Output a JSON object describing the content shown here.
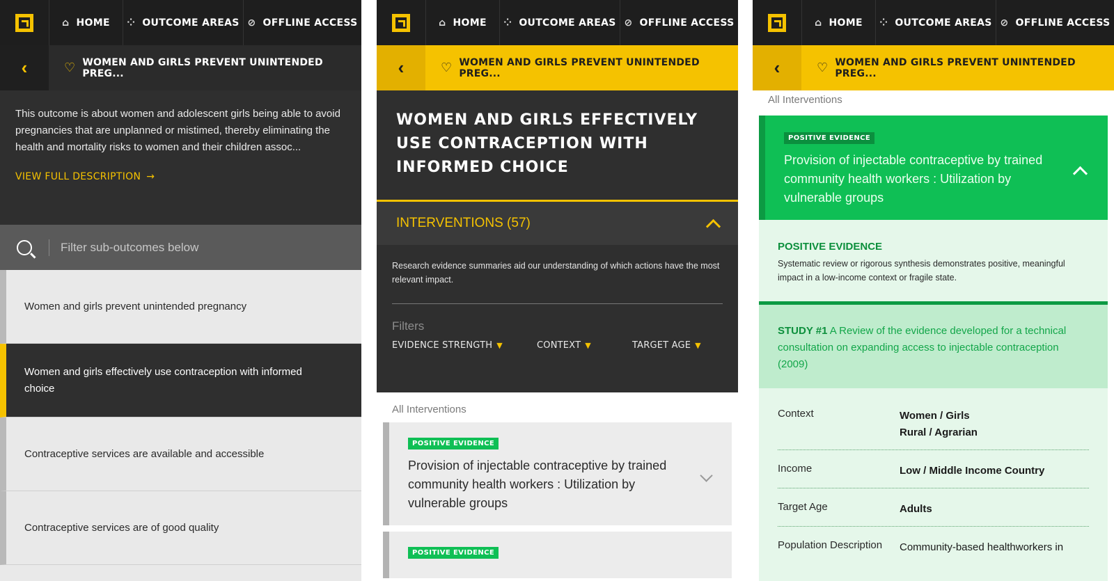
{
  "nav": {
    "home": "HOME",
    "outcome_areas": "OUTCOME AREAS",
    "offline_access": "OFFLINE ACCESS"
  },
  "breadcrumb": {
    "title": "WOMEN AND GIRLS PREVENT UNINTENDED PREG..."
  },
  "panel1": {
    "description": "This outcome is about women and adolescent girls being able to avoid pregnancies that are unplanned or mistimed, thereby eliminating the health and mortality risks to women and their children assoc...",
    "view_full": "VIEW FULL DESCRIPTION",
    "search_placeholder": "Filter sub-outcomes below",
    "sub_outcomes": [
      "Women and girls prevent unintended pregnancy",
      "Women and girls effectively use contraception with informed choice",
      "Contraceptive services are available and accessible",
      "Contraceptive services are of good quality"
    ]
  },
  "panel2": {
    "outcome_title": "WOMEN AND GIRLS EFFECTIVELY USE CONTRACEPTION WITH INFORMED CHOICE",
    "interventions_header": "INTERVENTIONS (57)",
    "interventions_desc": "Research evidence summaries aid our understanding of which actions have the most relevant impact.",
    "filters_label": "Filters",
    "filters": [
      "EVIDENCE STRENGTH",
      "CONTEXT",
      "TARGET AGE"
    ],
    "all_interventions": "All Interventions",
    "cards": [
      {
        "badge": "POSITIVE EVIDENCE",
        "title": "Provision of injectable contraceptive by trained community health workers : Utilization by vulnerable groups"
      },
      {
        "badge": "POSITIVE EVIDENCE",
        "title": ""
      }
    ]
  },
  "panel3": {
    "all_interventions": "All Interventions",
    "card": {
      "badge": "POSITIVE EVIDENCE",
      "title": "Provision of injectable contraceptive by trained community health workers : Utilization by vulnerable groups"
    },
    "evidence_heading": "POSITIVE EVIDENCE",
    "evidence_text": "Systematic review or rigorous synthesis demonstrates positive, meaningful impact in a low-income context or fragile state.",
    "study_number": "STUDY #1",
    "study_title": "A Review of the evidence developed for a technical consultation on expanding access to injectable contraception (2009)",
    "details": [
      {
        "label": "Context",
        "value_1": "Women / Girls",
        "value_2": "Rural / Agrarian"
      },
      {
        "label": "Income",
        "value_1": "Low / Middle Income Country"
      },
      {
        "label": "Target Age",
        "value_1": "Adults"
      },
      {
        "label": "Population Description",
        "value_1": "Community-based healthworkers in"
      }
    ]
  },
  "colors": {
    "accent_yellow": "#f5c200",
    "dark": "#1e1e1e",
    "positive_green": "#0fbf55"
  }
}
